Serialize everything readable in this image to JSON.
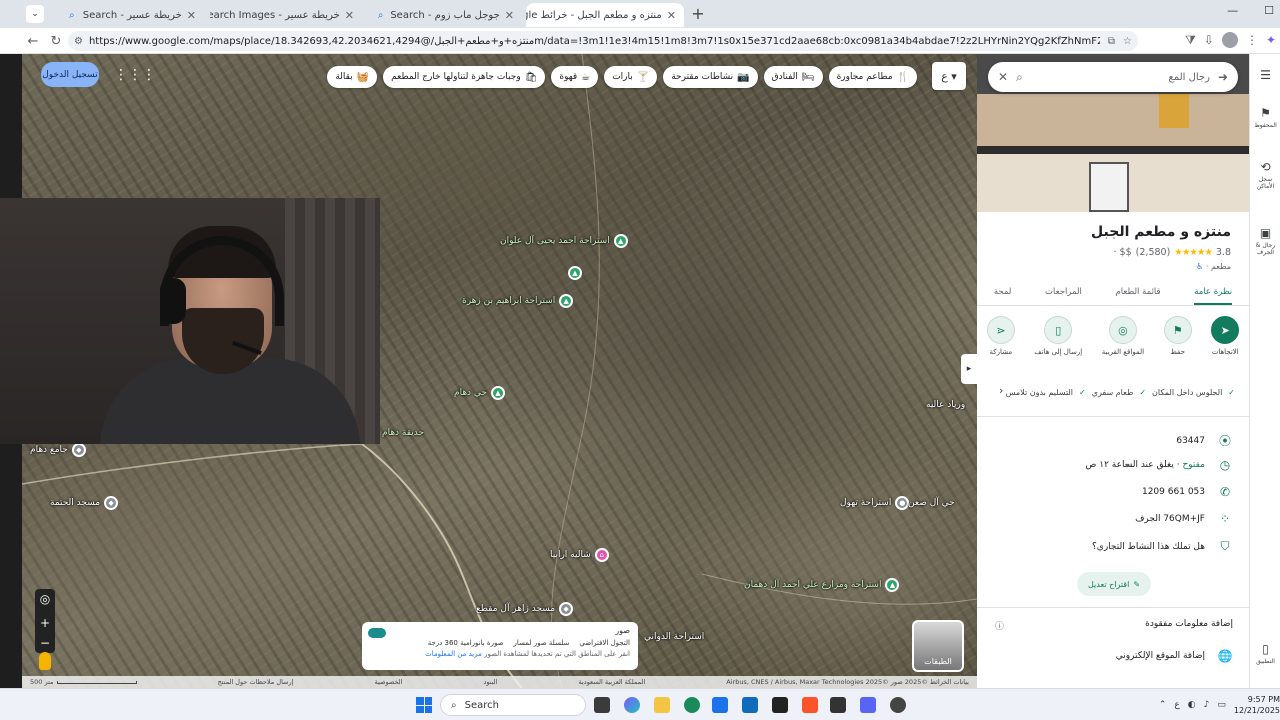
{
  "browser": {
    "tabs": [
      {
        "title": "خريطة عسير - Search",
        "icon": "search-icon",
        "active": false
      },
      {
        "title": "خريطة عسير - Search Images",
        "icon": "search-icon",
        "active": false
      },
      {
        "title": "جوجل ماب زوم - Search",
        "icon": "search-icon",
        "active": false
      },
      {
        "title": "منتزه و مطعم الجبل - خرائط Google",
        "icon": "maps-pin-icon",
        "active": true
      }
    ],
    "new_tab": "+",
    "url": "https://www.google.com/maps/place/منتزه+و+مطعم+الجبل/@18.342693,42.2034621,4294m/data=!3m1!1e3!4m15!1m8!3m7!1s0x15e371cd2aae68cb:0xc0981a34b4abdae7!2z2LHYrNin2YQg2KfZhNmF2Lkl3b1!8m2!3d18.1521824!4d42.157..."
  },
  "map": {
    "signin_label": "تسجيل الدخول",
    "chips": [
      {
        "label": "مطاعم مجاورة",
        "icon": "fork-knife-icon"
      },
      {
        "label": "الفنادق",
        "icon": "bed-icon"
      },
      {
        "label": "نشاطات مقترحة",
        "icon": "camera-icon"
      },
      {
        "label": "بارات",
        "icon": "cocktail-icon"
      },
      {
        "label": "قهوة",
        "icon": "coffee-icon"
      },
      {
        "label": "وجبات جاهزة لتناولها خارج المطعم",
        "icon": "takeout-icon"
      },
      {
        "label": "بقالة",
        "icon": "basket-icon"
      }
    ],
    "more_chip": "ع",
    "places": [
      {
        "label": "استراحة احمد يحيى آل علوان",
        "style": "green"
      },
      {
        "label": "استراحة ابراهيم بن زهرة",
        "style": "green"
      },
      {
        "label": "حي دهام",
        "style": "green"
      },
      {
        "label": "حديقة دهام",
        "style": "green"
      },
      {
        "label": "جامع دهام",
        "style": "gray"
      },
      {
        "label": "مسجد الحتمة",
        "style": "gray"
      },
      {
        "label": "استراحة تهول",
        "style": "gray"
      },
      {
        "label": "شاليه ارابيا",
        "style": "pink"
      },
      {
        "label": "استراحة ومزارع علي احمد آل دهمان",
        "style": "green"
      },
      {
        "label": "مسجد زاهر آل مقطع",
        "style": "gray"
      },
      {
        "label": "استراحة الدواني",
        "style": "gray"
      },
      {
        "label": "حي آل صعن",
        "style": "gray"
      },
      {
        "label": "ورياد عاليه",
        "style": "gray"
      }
    ],
    "layers_label": "الطبقات",
    "photos_card": {
      "title": "صور",
      "default_label": "التجول الافتراضي",
      "series_label": "سلسلة صور لمسار",
      "pano_label": "صورة بانورامية 360 درجة",
      "note": "انقر على المناطق التي تم تحديدها لمشاهدة الصور",
      "link": "مزيد من المعلومات"
    },
    "footer": {
      "attribution": "بيانات الخرائط ©2025 صور ©2025 Airbus, CNES / Airbus, Maxar Technologies",
      "country": "المملكة العربية السعودية",
      "terms": "البنود",
      "privacy": "الخصوصية",
      "feedback": "إرسال ملاحظات حول المنتج",
      "scale": "500 متر"
    }
  },
  "panel": {
    "search_value": "رجال المع",
    "title": "منتزه و مطعم الجبل",
    "rating": "3.8",
    "stars": "★★★★★",
    "reviews": "(2,580)",
    "price": "$$ ·",
    "category": "مطعم ·",
    "tabs": [
      "نظرة عامة",
      "قائمة الطعام",
      "المراجعات",
      "لمحة"
    ],
    "actions": [
      {
        "label": "الاتجاهات",
        "icon": "directions-icon",
        "glyph": "➤"
      },
      {
        "label": "حفظ",
        "icon": "bookmark-icon",
        "glyph": "⚑"
      },
      {
        "label": "المواقع القريبة",
        "icon": "nearby-icon",
        "glyph": "◎"
      },
      {
        "label": "إرسال إلى هاتف",
        "icon": "phone-send-icon",
        "glyph": "▯"
      },
      {
        "label": "مشاركة",
        "icon": "share-icon",
        "glyph": "⋖"
      }
    ],
    "features": [
      "الجلوس داخل المكان",
      "طعام سفري",
      "التسليم بدون تلامس"
    ],
    "info": {
      "postal": "63447",
      "hours_status": "مفتوح",
      "hours_rest": " · يغلق عند الساعة ١٢ ص",
      "phone": "053 661 1209",
      "plus_code": "76QM+JF الجرف",
      "claim": "هل تملك هذا النشاط التجاري؟"
    },
    "suggest_edit": "اقتراح تعديل",
    "missing_title": "إضافة معلومات مفقودة",
    "add_website": "إضافة الموقع الإلكتروني"
  },
  "rail": [
    {
      "label": "المحفوظ",
      "icon": "bookmark-icon",
      "glyph": "⚑"
    },
    {
      "label": "سجل الأماكن",
      "icon": "history-icon",
      "glyph": "⟲"
    },
    {
      "label": "رجال & الجرف",
      "icon": "recent-place-icon",
      "glyph": "▣"
    },
    {
      "label": "التطبيق",
      "icon": "phone-icon",
      "glyph": "▯"
    }
  ],
  "taskbar": {
    "search_label": "Search",
    "time": "9:57 PM",
    "date": "12/21/2025",
    "lang": "ع"
  }
}
